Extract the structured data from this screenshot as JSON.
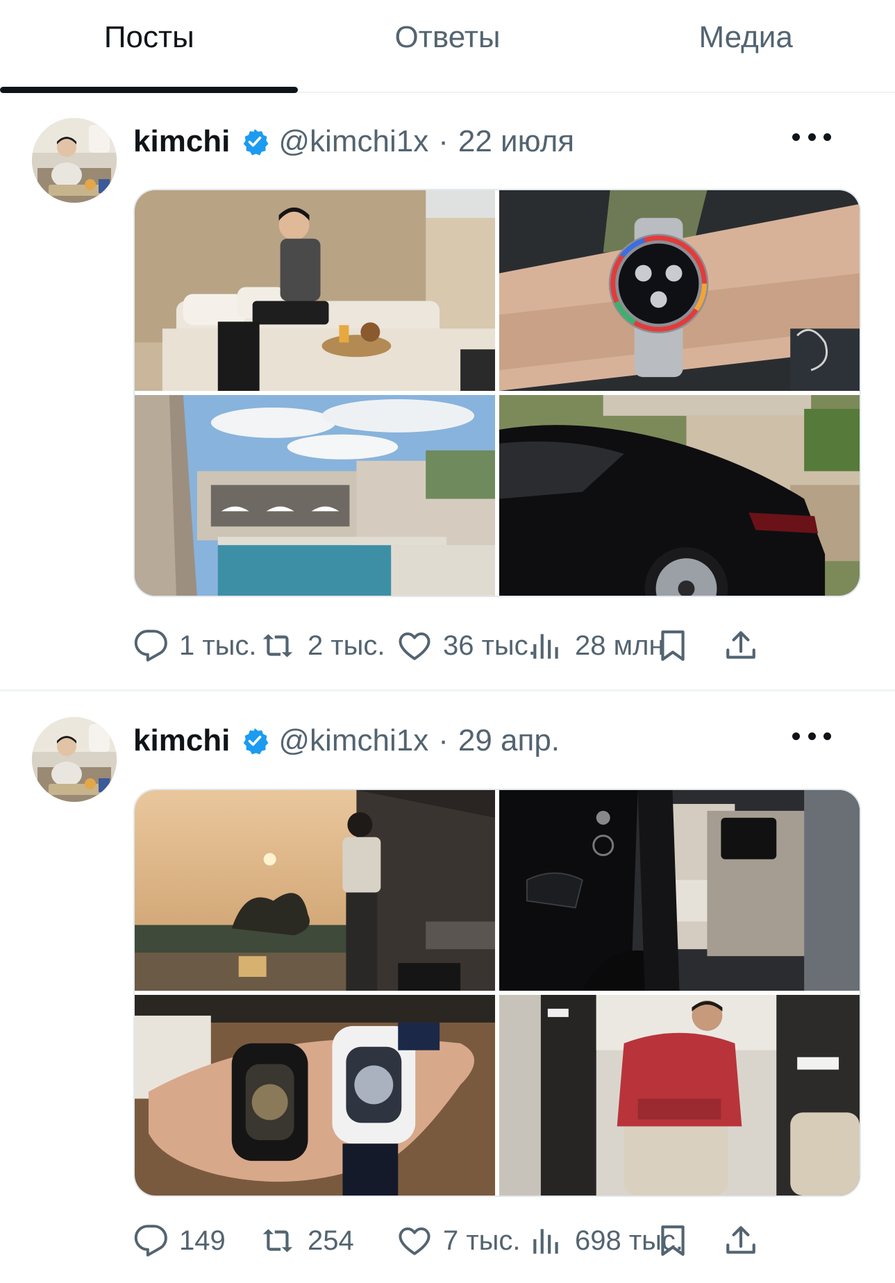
{
  "tabs": [
    {
      "label": "Посты",
      "active": true
    },
    {
      "label": "Ответы",
      "active": false
    },
    {
      "label": "Медиа",
      "active": false
    }
  ],
  "posts": [
    {
      "name": "kimchi",
      "handle": "@kimchi1x",
      "separator": "·",
      "date": "22 июля",
      "media": [
        "photo-lounge-desert",
        "photo-rainbow-watch",
        "photo-pool-resort",
        "photo-black-car"
      ],
      "stats": {
        "replies": "1 тыс.",
        "reposts": "2 тыс.",
        "likes": "36 тыс.",
        "views": "28 млн"
      }
    },
    {
      "name": "kimchi",
      "handle": "@kimchi1x",
      "separator": "·",
      "date": "29 апр.",
      "media": [
        "photo-sunset-terrace",
        "photo-car-interior",
        "photo-watches-hand",
        "photo-jet-cabin"
      ],
      "stats": {
        "replies": "149",
        "reposts": "254",
        "likes": "7 тыс.",
        "views": "698 тыс."
      }
    }
  ],
  "icons": {
    "verified": "verified-badge-icon",
    "more": "more-icon",
    "reply": "reply-icon",
    "repost": "repost-icon",
    "like": "heart-icon",
    "views": "views-icon",
    "bookmark": "bookmark-icon",
    "share": "share-icon"
  },
  "colors": {
    "verified": "#1d9bf0",
    "text": "#0f1419",
    "secondary": "#536471",
    "divider": "#eff3f4"
  }
}
